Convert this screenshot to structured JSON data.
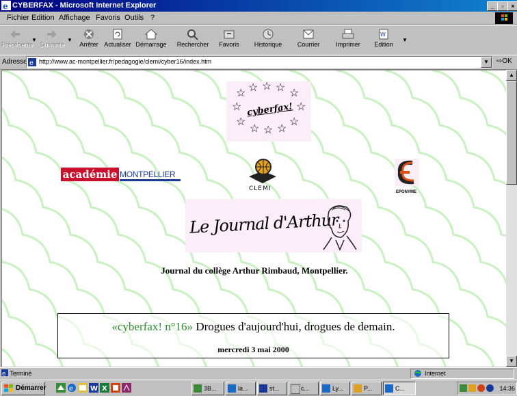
{
  "window": {
    "title": "CYBERFAX - Microsoft Internet Explorer"
  },
  "menu": {
    "items": [
      "Fichier",
      "Edition",
      "Affichage",
      "Favoris",
      "Outils",
      "?"
    ]
  },
  "toolbar": {
    "buttons": [
      {
        "label": "Précédente",
        "icon": "back-arrow-icon",
        "enabled": false
      },
      {
        "label": "Suivante",
        "icon": "forward-arrow-icon",
        "enabled": false
      },
      {
        "label": "Arrêter",
        "icon": "stop-icon",
        "enabled": true
      },
      {
        "label": "Actualiser",
        "icon": "refresh-icon",
        "enabled": true
      },
      {
        "label": "Démarrage",
        "icon": "home-icon",
        "enabled": true
      },
      {
        "label": "Rechercher",
        "icon": "search-icon",
        "enabled": true
      },
      {
        "label": "Favoris",
        "icon": "favorites-icon",
        "enabled": true
      },
      {
        "label": "Historique",
        "icon": "history-icon",
        "enabled": true
      },
      {
        "label": "Courrier",
        "icon": "mail-icon",
        "enabled": true
      },
      {
        "label": "Imprimer",
        "icon": "print-icon",
        "enabled": true
      },
      {
        "label": "Edition",
        "icon": "edit-icon",
        "enabled": true
      }
    ]
  },
  "address": {
    "label": "Adresse",
    "url": "http://www.ac-montpellier.fr/pedagogie/clemi/cyber16/index.htm",
    "go_label": "OK"
  },
  "page": {
    "cyberfax_logo_text": "cyberfax!",
    "academie_left": "académie",
    "academie_right": "MONTPELLIER",
    "clemi_text": "CLEMI",
    "eponyme_text": "EPONYME",
    "journal_title": "Le Journal d'Arthur",
    "subtitle": "Journal du collège Arthur Rimbaud, Montpellier.",
    "issue_number": "«cyberfax! n°16»",
    "issue_title": " Drogues d'aujourd'hui, drogues de demain.",
    "issue_date": "mercredi 3 mai 2000",
    "background_color": "#ffffff",
    "wave_color": "#c8f0c0",
    "issue_number_color": "#2e8b2e",
    "academie_red": "#c8102e",
    "academie_blue": "#1a3a9a"
  },
  "status": {
    "left_text": "Terminé",
    "zone_text": "Internet"
  },
  "taskbar": {
    "start_label": "Démarrer",
    "tasks": [
      "3B...",
      "la...",
      "st...",
      "c...",
      "Ly...",
      "P...",
      "C..."
    ],
    "clock": "14:36"
  }
}
